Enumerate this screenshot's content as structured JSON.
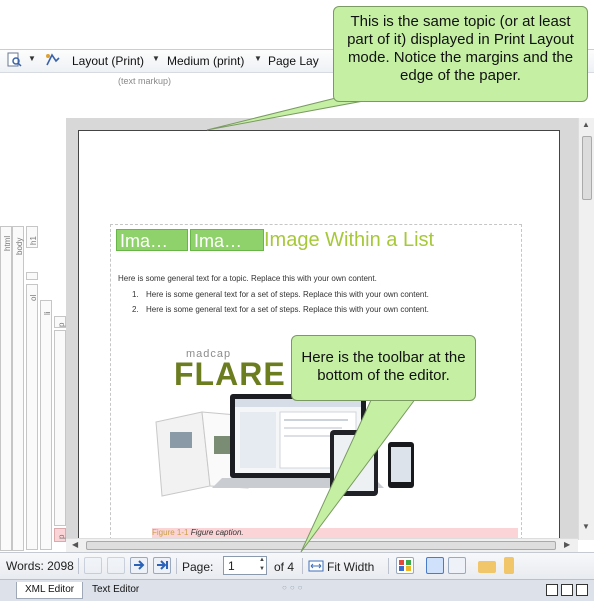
{
  "toolbar": {
    "layout_label": "Layout (Print)",
    "medium_label": "Medium (print)",
    "page_label": "Page Lay"
  },
  "text_markup_label": "(text markup)",
  "structure_labels": [
    "html",
    "body",
    "h1",
    "ol",
    "li",
    "p",
    "p"
  ],
  "document": {
    "heading_chip_1": "Ima…",
    "heading_chip_2": "Ima…",
    "heading": "Image Within a List",
    "intro": "Here is some general text for a topic. Replace this with your own content.",
    "steps": [
      {
        "num": "1.",
        "text": "Here is some general text for a set of steps. Replace this with your own content."
      },
      {
        "num": "2.",
        "text": "Here is some general text for a set of steps. Replace this with your own content."
      }
    ],
    "image_brand_small": "madcap",
    "image_brand_large": "FLARE",
    "figure_label": "Figure 1-1",
    "figure_caption": "Figure caption."
  },
  "bottom_bar": {
    "words_label": "Words: 2098",
    "page_label": "Page:",
    "page_value": "1",
    "page_of": "of 4",
    "fit_width_label": "Fit Width"
  },
  "tabs": {
    "xml_editor": "XML Editor",
    "text_editor": "Text Editor"
  },
  "callouts": {
    "top": "This is the same topic (or at least part of it) displayed in Print Layout mode. Notice the margins and the edge of the paper.",
    "bottom": "Here is the toolbar at the bottom of the editor."
  },
  "colors": {
    "callout_fill": "#c5f0a4",
    "heading_green": "#a7c83a",
    "caption_pink": "#fad4d6"
  }
}
